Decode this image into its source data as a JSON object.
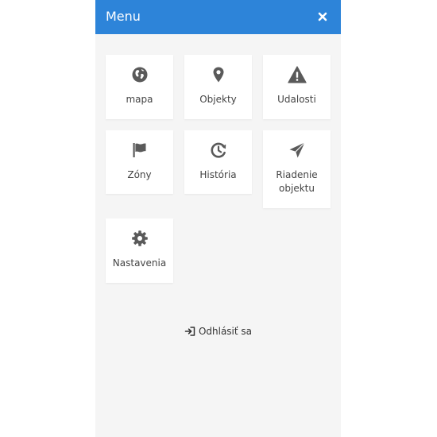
{
  "header": {
    "title": "Menu",
    "close_icon": "close-icon"
  },
  "colors": {
    "header_bg": "#2d84d9",
    "icon": "#5a5a5a",
    "panel_bg": "#f5f5f5"
  },
  "menu": {
    "items": [
      {
        "label": "mapa",
        "icon": "globe-icon"
      },
      {
        "label": "Objekty",
        "icon": "map-pin-icon"
      },
      {
        "label": "Udalosti",
        "icon": "warning-icon"
      },
      {
        "label": "Zóny",
        "icon": "flag-icon"
      },
      {
        "label": "História",
        "icon": "history-icon"
      },
      {
        "label": "Riadenie objektu",
        "icon": "paper-plane-icon"
      },
      {
        "label": "Nastavenia",
        "icon": "gear-icon"
      }
    ]
  },
  "logout": {
    "label": "Odhlásiť sa",
    "icon": "sign-out-icon"
  }
}
